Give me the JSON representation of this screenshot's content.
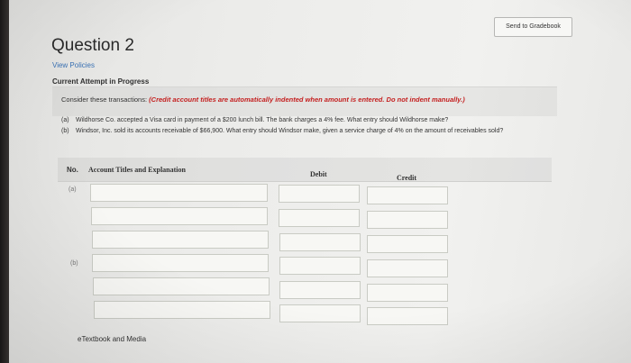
{
  "toolbar": {
    "send_to_gradebook": "Send to Gradebook"
  },
  "question": {
    "title": "Question 2",
    "view_policies": "View Policies",
    "status": "Current Attempt in Progress"
  },
  "prompt": {
    "lead": "Consider these transactions:",
    "note": "(Credit account titles are automatically indented when amount is entered. Do not indent manually.)",
    "a_tag": "(a)",
    "a_text": "Wildhorse Co. accepted a Visa card in payment of a $200 lunch bill. The bank charges a 4% fee. What entry should Wildhorse make?",
    "b_tag": "(b)",
    "b_text": "Windsor, Inc. sold its accounts receivable of $66,900. What entry should Windsor make, given a service charge of 4% on the amount of receivables sold?"
  },
  "table": {
    "col_no": "No.",
    "col_account": "Account Titles and Explanation",
    "col_debit": "Debit",
    "col_credit": "Credit",
    "row_a": "(a)",
    "row_b": "(b)"
  },
  "footer": {
    "etextbook": "eTextbook and Media"
  }
}
